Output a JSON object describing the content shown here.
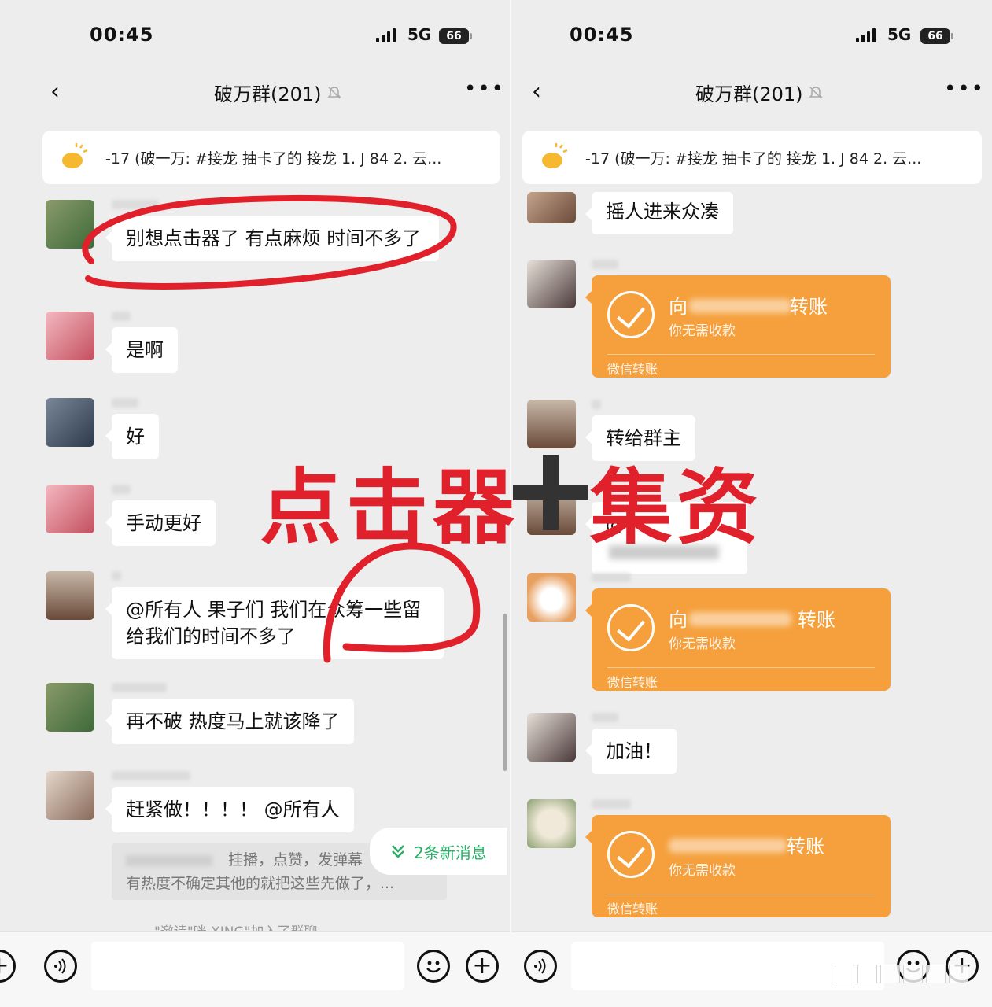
{
  "left": {
    "status": {
      "time": "00:45",
      "network": "5G",
      "battery": "66"
    },
    "nav": {
      "title": "破万群(201)"
    },
    "pinned": {
      "text": "-17 (破一万: #接龙 抽卡了的 接龙  1. J 84 2. 云..."
    },
    "messages": [
      {
        "text": "别想点击器了 有点麻烦 时间不多了"
      },
      {
        "text": "是啊"
      },
      {
        "text": "好"
      },
      {
        "text": "手动更好"
      },
      {
        "text": "@所有人 果子们 我们在众筹一些留给我们的时间不多了"
      },
      {
        "text": "再不破 热度马上就该降了"
      },
      {
        "text": "赶紧做！！！！ @所有人"
      }
    ],
    "quote": {
      "line1": "挂播，点赞，发弹幕",
      "line2": "有热度不确定其他的就把这些先做了，..."
    },
    "new_messages": "2条新消息",
    "system": "\"邀请\"咪 XING\"加入了群聊"
  },
  "right": {
    "status": {
      "time": "00:45",
      "network": "5G",
      "battery": "66"
    },
    "nav": {
      "title": "破万群(201)"
    },
    "pinned": {
      "text": "-17 (破一万: #接龙 抽卡了的 接龙  1. J 84 2. 云..."
    },
    "messages": [
      {
        "text": "摇人进来众凑"
      },
      {
        "text": "转给群主"
      },
      {
        "text": "@"
      },
      {
        "text": "加油！"
      }
    ],
    "transfers": [
      {
        "title_prefix": "向",
        "title_suffix": "转账",
        "subtitle": "你无需收款",
        "footer": "微信转账"
      },
      {
        "title_prefix": "向",
        "title_suffix": "转账",
        "subtitle": "你无需收款",
        "footer": "微信转账"
      },
      {
        "title_prefix": "",
        "title_suffix": "转账",
        "subtitle": "你无需收款",
        "footer": "微信转账"
      }
    ]
  },
  "overlay": {
    "text_left": "点击器",
    "text_right": "集资"
  },
  "colors": {
    "annotation_red": "#e0202a",
    "transfer_orange": "#f5a03c",
    "wechat_green": "#2aae67"
  },
  "icons": [
    "back-arrow-icon",
    "mute-bell-icon",
    "more-dots-icon",
    "announcement-icon",
    "voice-icon",
    "emoji-icon",
    "plus-icon",
    "check-icon",
    "double-chevron-down-icon"
  ]
}
